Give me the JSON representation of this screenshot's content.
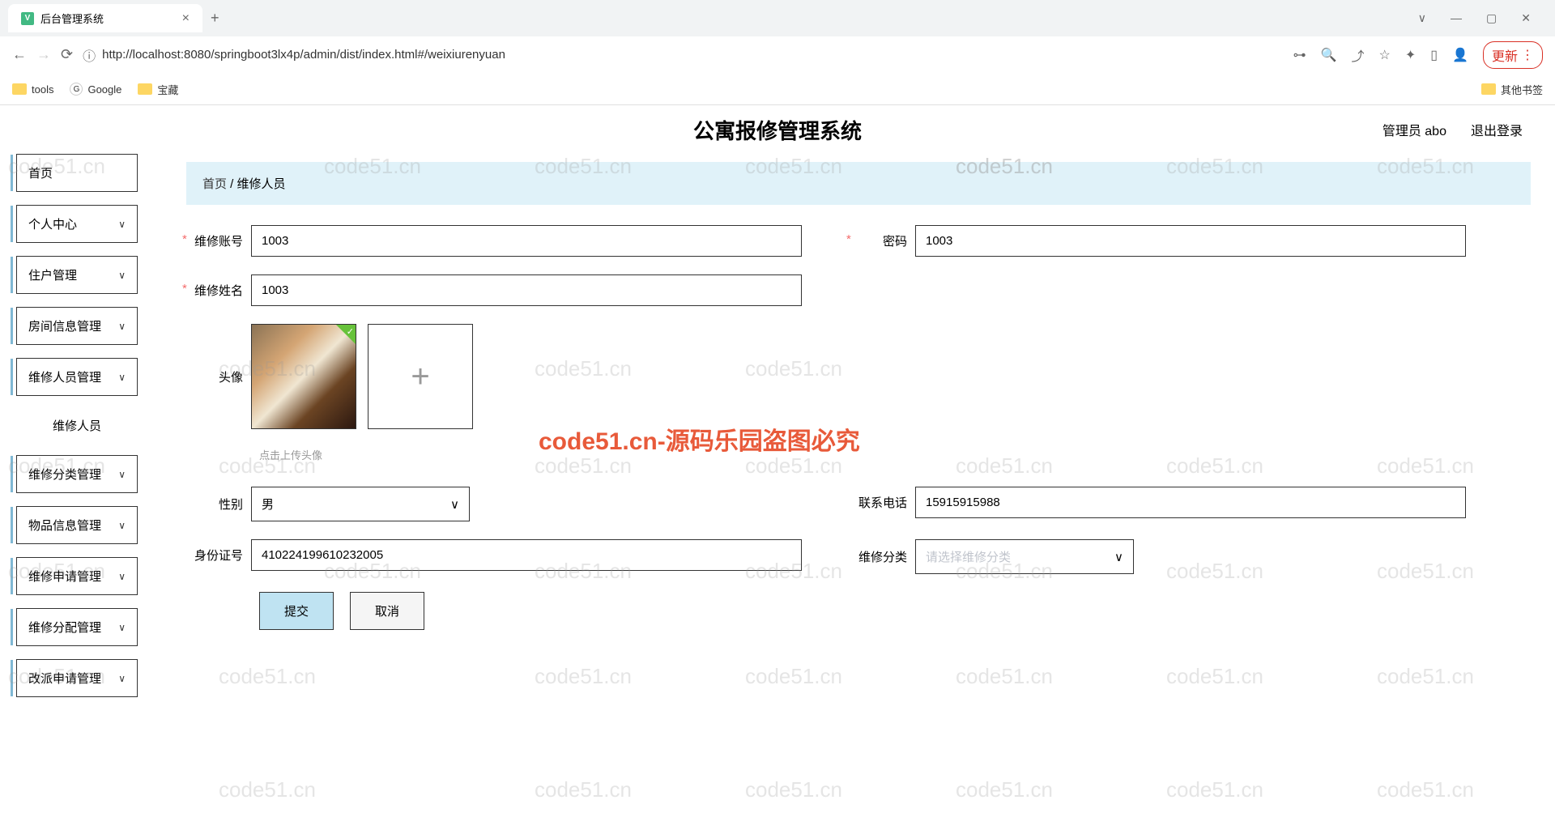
{
  "browser": {
    "tab_title": "后台管理系统",
    "url": "http://localhost:8080/springboot3lx4p/admin/dist/index.html#/weixiurenyuan",
    "update_label": "更新",
    "bookmarks": {
      "tools": "tools",
      "google": "Google",
      "baozang": "宝藏",
      "other": "其他书签"
    }
  },
  "header": {
    "app_title": "公寓报修管理系统",
    "user_label": "管理员 abo",
    "logout_label": "退出登录"
  },
  "sidebar": {
    "items": [
      {
        "label": "首页",
        "expandable": false
      },
      {
        "label": "个人中心",
        "expandable": true
      },
      {
        "label": "住户管理",
        "expandable": true
      },
      {
        "label": "房间信息管理",
        "expandable": true
      },
      {
        "label": "维修人员管理",
        "expandable": true
      },
      {
        "label": "维修分类管理",
        "expandable": true
      },
      {
        "label": "物品信息管理",
        "expandable": true
      },
      {
        "label": "维修申请管理",
        "expandable": true
      },
      {
        "label": "维修分配管理",
        "expandable": true
      },
      {
        "label": "改派申请管理",
        "expandable": true
      }
    ],
    "submenu_label": "维修人员"
  },
  "breadcrumb": {
    "home": "首页",
    "sep": " / ",
    "current": "维修人员"
  },
  "form": {
    "repair_account": {
      "label": "维修账号",
      "value": "1003"
    },
    "password": {
      "label": "密码",
      "value": "1003"
    },
    "repair_name": {
      "label": "维修姓名",
      "value": "1003"
    },
    "avatar": {
      "label": "头像",
      "hint": "点击上传头像",
      "plus_symbol": "+"
    },
    "gender": {
      "label": "性别",
      "value": "男"
    },
    "phone": {
      "label": "联系电话",
      "value": "15915915988"
    },
    "id_number": {
      "label": "身份证号",
      "value": "410224199610232005"
    },
    "repair_category": {
      "label": "维修分类",
      "placeholder": "请选择维修分类"
    }
  },
  "buttons": {
    "submit": "提交",
    "cancel": "取消"
  },
  "watermark": "code51.cn-源码乐园盗图必究",
  "watermark_bg": "code51.cn"
}
